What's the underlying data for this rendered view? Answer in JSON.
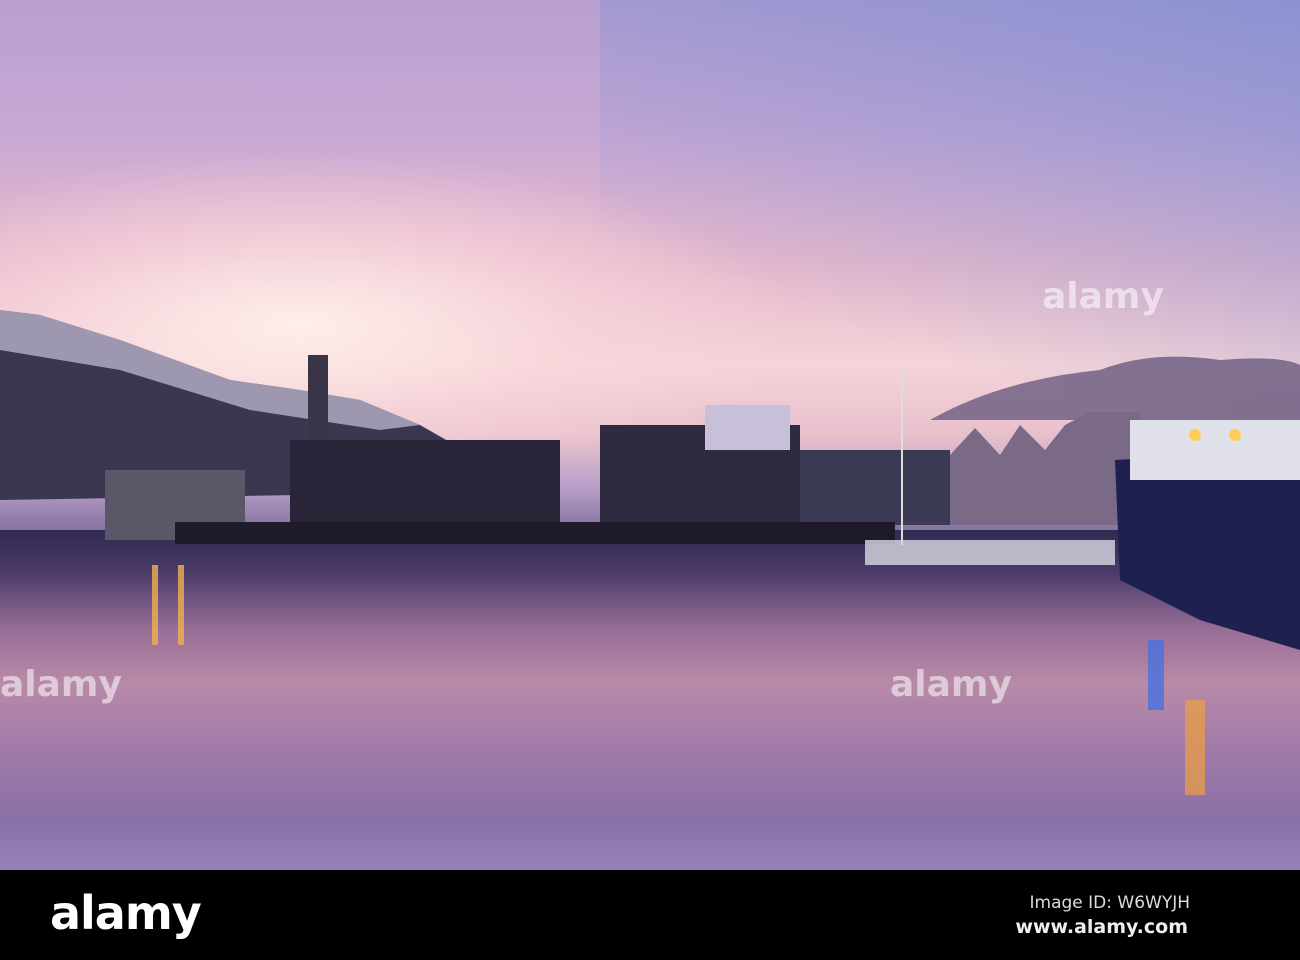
{
  "photo": {
    "subject": "harbour-at-dusk"
  },
  "watermark": {
    "text": "alamy"
  },
  "footer": {
    "logo": "alamy",
    "image_id": "Image ID: W6WYJH",
    "site": "www.alamy.com"
  }
}
